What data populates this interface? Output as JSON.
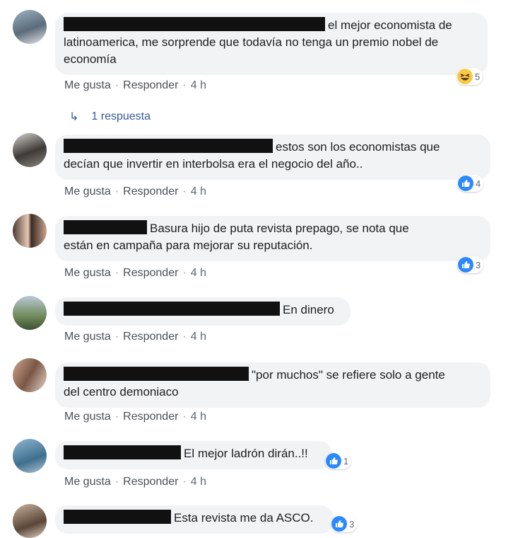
{
  "colors": {
    "bubble": "#f2f3f5",
    "like_blue": "#2d88ff",
    "haha_yellow": "#f7c948",
    "redaction": "#111111"
  },
  "actions": {
    "like": "Me gusta",
    "reply": "Responder",
    "separator": "·"
  },
  "comments": [
    {
      "time": "4 h",
      "text_line1": "el mejor economista de",
      "text_rest": "latinoamerica, me sorprende que todavía no tenga un premio nobel de economía",
      "reaction": {
        "icon": "haha-icon",
        "count": "5"
      }
    },
    {
      "time": "4 h",
      "text_line1": "estos son los economistas que",
      "text_rest": "decían que invertir en interbolsa era el negocio del año..",
      "reaction": {
        "icon": "like-icon",
        "count": "4"
      }
    },
    {
      "time": "4 h",
      "text_line1": "Basura hijo de puta revista prepago, se nota que",
      "text_rest": "están en campaña para mejorar su reputación.",
      "reaction": {
        "icon": "like-icon",
        "count": "3"
      }
    },
    {
      "time": "4 h",
      "text_line1": "En dinero",
      "text_rest": ""
    },
    {
      "time": "4 h",
      "text_line1": "\"por muchos\" se refiere solo a gente",
      "text_rest": "del centro demoniaco"
    },
    {
      "time": "4 h",
      "text_line1": "El mejor ladrón dirán..!!",
      "text_rest": "",
      "reaction": {
        "icon": "like-icon",
        "count": "1"
      }
    },
    {
      "time": "",
      "text_line1": "Esta revista me da ASCO.",
      "text_rest": "",
      "reaction": {
        "icon": "like-icon",
        "count": "3"
      }
    }
  ],
  "replies_link": "1 respuesta"
}
